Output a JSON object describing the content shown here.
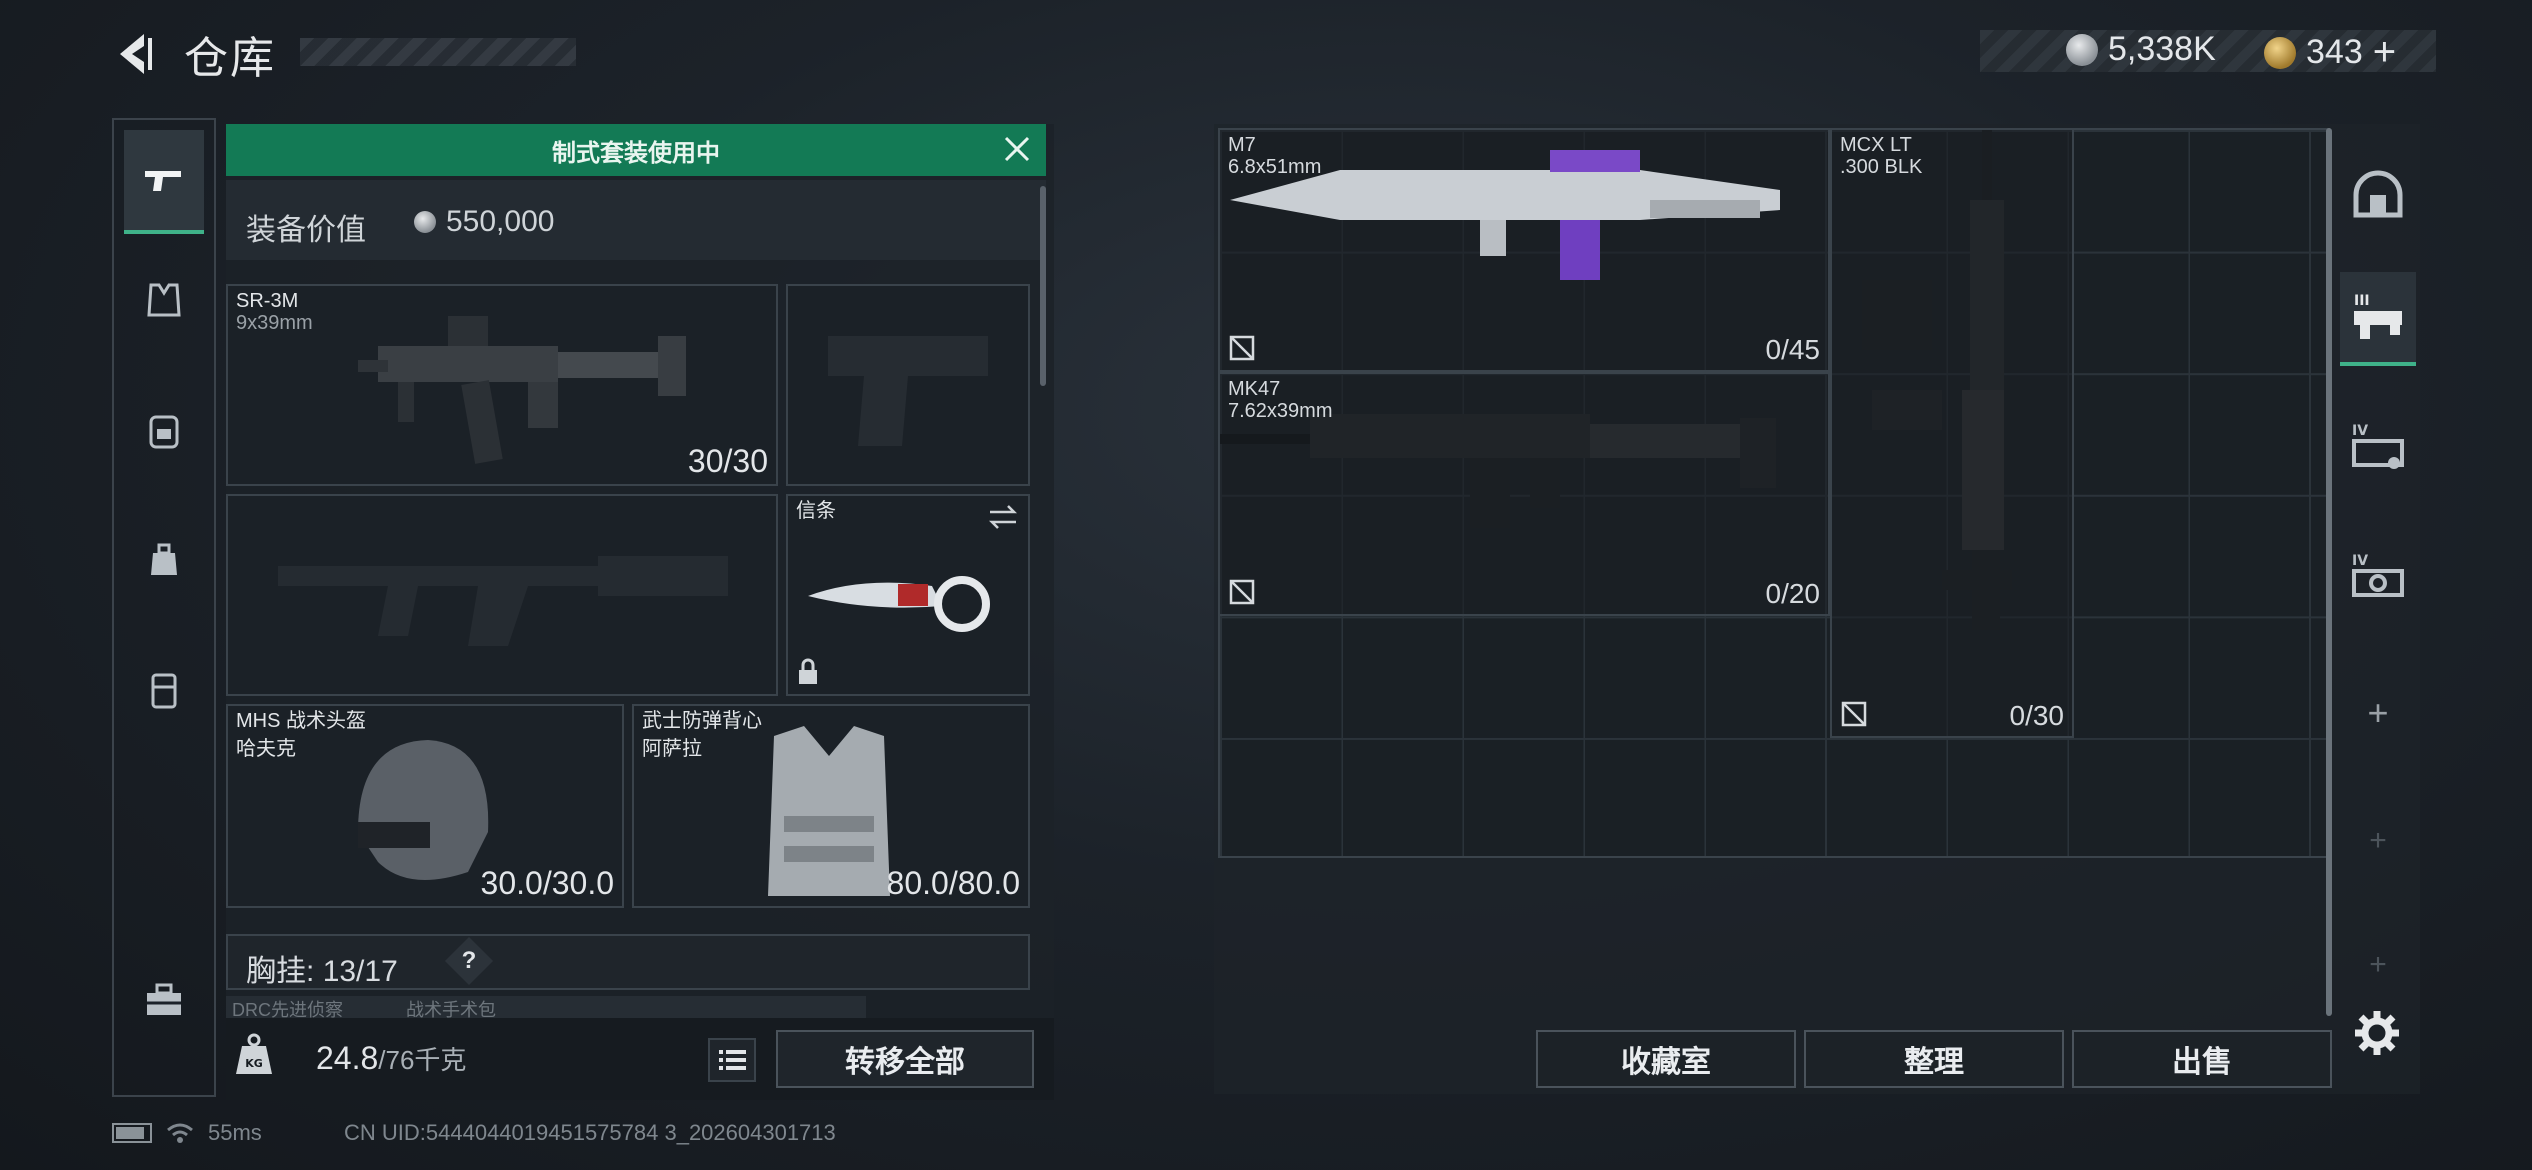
{
  "header": {
    "title": "仓库",
    "currency_silver": "5,338K",
    "currency_gold": "343",
    "currency_plus": "+"
  },
  "loadout": {
    "banner": "制式套装使用中",
    "equip_value_label": "装备价值",
    "equip_value": "550,000",
    "primary": {
      "name": "SR-3M",
      "caliber": "9x39mm",
      "ammo": "30/30"
    },
    "melee": {
      "name": "信条"
    },
    "helmet": {
      "name": "MHS 战术头盔",
      "sub": "哈夫克",
      "durability": "30.0/30.0"
    },
    "armor": {
      "name": "武士防弹背心",
      "sub": "阿萨拉",
      "durability": "80.0/80.0"
    },
    "chest_rig_label": "胸挂:",
    "chest_rig_count": "13/17",
    "chest_rig_help": "?",
    "sub_slots": [
      "DRC先进侦察",
      "战术手术包",
      ""
    ],
    "weight": "24.8",
    "weight_max": "/76千克",
    "transfer_all": "转移全部"
  },
  "stash": {
    "items": [
      {
        "name": "M7",
        "caliber": "6.8x51mm",
        "ammo": "0/45"
      },
      {
        "name": "MK47",
        "caliber": "7.62x39mm",
        "ammo": "0/20"
      },
      {
        "name": "MCX LT",
        "caliber": ".300 BLK",
        "ammo": "0/30"
      }
    ],
    "buttons": {
      "collection": "收藏室",
      "sort": "整理",
      "sell": "出售"
    },
    "plus": "+"
  },
  "status": {
    "ping": "55ms",
    "uid": "CN UID:5444044019451575784 3_202604301713"
  },
  "colors": {
    "accent": "#3fb289",
    "banner": "#137a55"
  },
  "icons": [
    "back-arrow-icon",
    "pistol-icon",
    "vest-icon",
    "backpack-icon",
    "pouch-icon",
    "container-icon",
    "toolbox-icon",
    "gear-icon"
  ]
}
